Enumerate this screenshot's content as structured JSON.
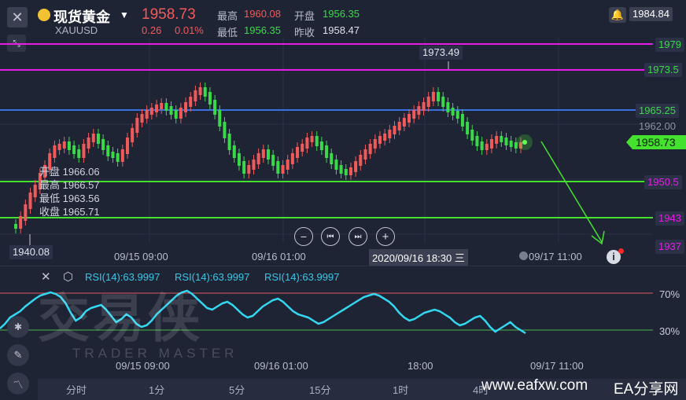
{
  "header": {
    "close_icon": "close-icon",
    "product_name": "现货黄金",
    "product_code": "XAUUSD",
    "last_price": "1958.73",
    "change": "0.26",
    "change_pct": "0.01%",
    "high_label": "最高",
    "high_value": "1960.08",
    "open_label": "开盘",
    "open_value": "1956.35",
    "low_label": "最低",
    "low_value": "1956.35",
    "prev_close_label": "昨收",
    "prev_close_value": "1958.47",
    "alert_icon": "bell-icon",
    "right_price": "1984.84",
    "colors": {
      "up": "#f25a5a",
      "down": "#3bd94a",
      "bg": "#1f2435"
    }
  },
  "price_levels": [
    {
      "label": "1979",
      "color": "#e81ce8",
      "text_color": "#3bd94a"
    },
    {
      "label": "1973.5",
      "color": "#e81ce8",
      "text_color": "#3bd94a"
    },
    {
      "label": "1965.25",
      "color": "#3a6fe0",
      "text_color": "#3bd94a"
    },
    {
      "label": "1962.00",
      "color": "none",
      "text_color": "#8c92a4"
    },
    {
      "label": "1950.5",
      "color": "#44e22e",
      "text_color": "#e81ce8"
    },
    {
      "label": "1943",
      "color": "#44e22e",
      "text_color": "#e81ce8"
    },
    {
      "label": "1937",
      "color": "none",
      "text_color": "#e81ce8"
    }
  ],
  "current_price_tag": "1958.73",
  "peak_label": "1973.49",
  "low_marker": "1940.08",
  "ohlc_overlay": {
    "open": "开盘 1966.06",
    "high": "最高 1966.57",
    "low": "最低 1963.56",
    "close": "收盘 1965.71"
  },
  "time_axis": {
    "t1": "09/15 09:00",
    "t2": "09/16 01:00",
    "crosshair": "2020/09/16 18:30 三",
    "t3": "09/17 11:00"
  },
  "rsi": {
    "label1": "RSI(14):63.9997",
    "label2": "RSI(14):63.9997",
    "label3": "RSI(14):63.9997",
    "level_high": "70%",
    "level_low": "30%",
    "watermark_main": "交易侠",
    "watermark_sub": "TRADER MASTER"
  },
  "rsi_time_axis": {
    "t1": "09/15 09:00",
    "t2": "09/16 01:00",
    "t3": "18:00",
    "t4": "09/17 11:00"
  },
  "bottom_tabs": [
    "分时",
    "1分",
    "5分",
    "15分",
    "1时",
    "4时"
  ],
  "footer_watermark": "www.eafxw.com",
  "footer_brand": "EA分享网"
}
